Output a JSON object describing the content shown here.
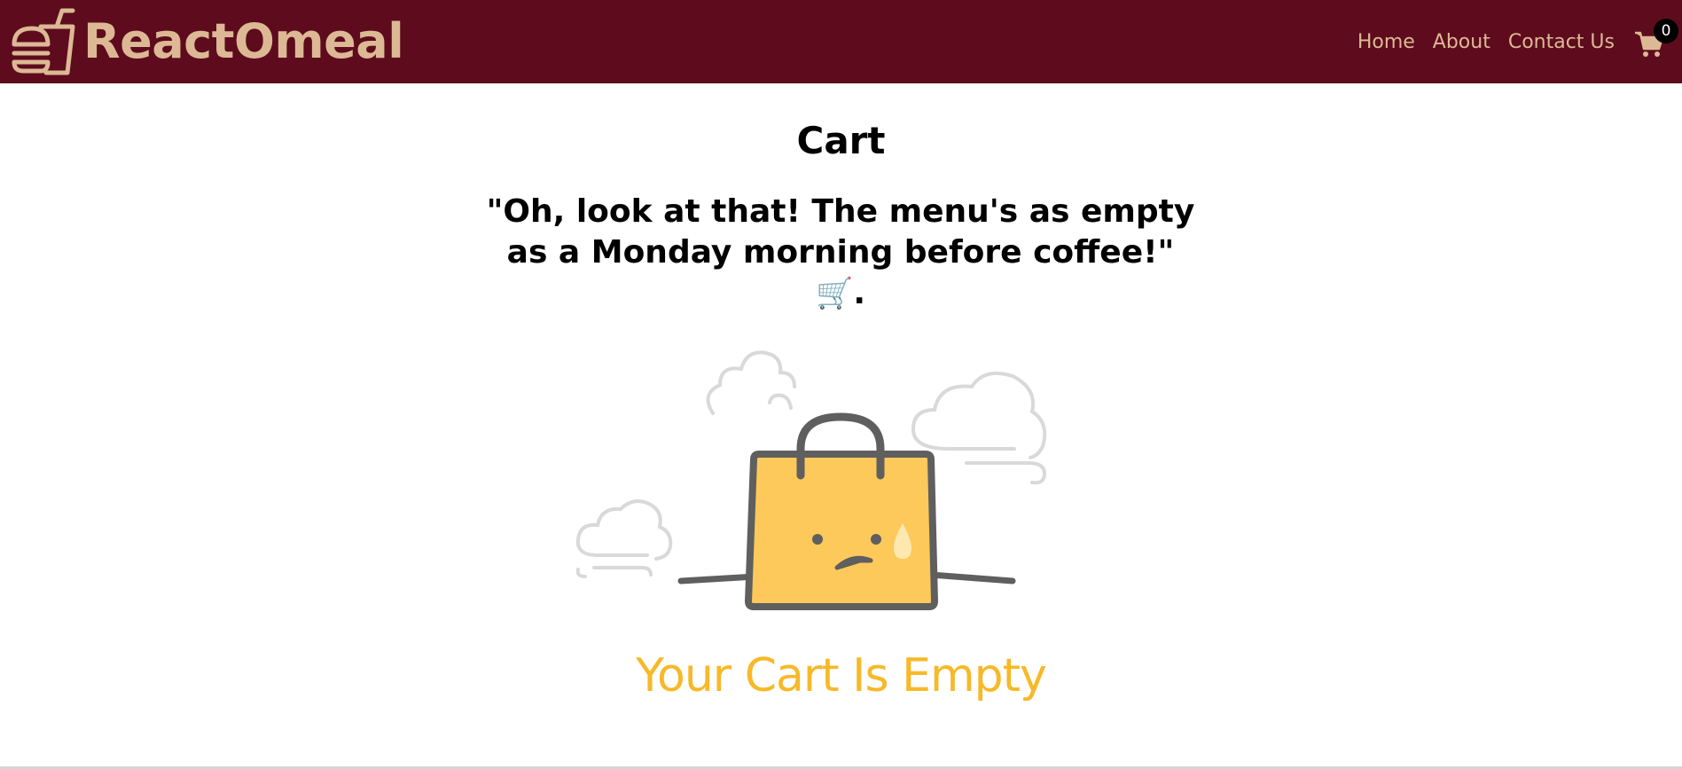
{
  "brand": {
    "name": "ReactOmeal",
    "logo_icon": "burger-drink-icon",
    "color": "#dcb994"
  },
  "nav": {
    "background": "#5e0b1e",
    "links": [
      "Home",
      "About",
      "Contact Us"
    ],
    "cart_icon": "shopping-cart-icon",
    "cart_count": "0"
  },
  "main": {
    "title": "Cart",
    "message": "\"Oh, look at that! The menu's as empty as a Monday morning before coffee!\"",
    "message_emoji": "🛒",
    "message_suffix": ".",
    "illustration_icon": "sad-shopping-bag-icon",
    "caption": "Your Cart Is Empty",
    "caption_color": "#f7b928"
  }
}
